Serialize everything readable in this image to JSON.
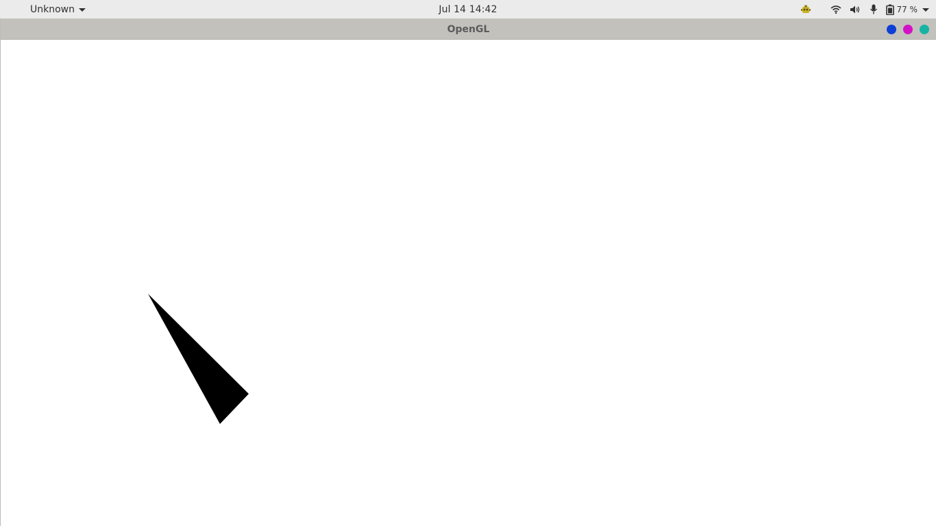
{
  "topbar": {
    "activities_label": "Unknown",
    "clock": "Jul 14  14:42",
    "battery_percent": "77 %",
    "icons": [
      "app-indicator-icon",
      "wifi-icon",
      "volume-icon",
      "microphone-icon",
      "battery-icon",
      "system-menu-caret-icon"
    ]
  },
  "window": {
    "title": "OpenGL",
    "controls": [
      {
        "name": "minimize",
        "color": "#0f3fd6"
      },
      {
        "name": "maximize",
        "color": "#d312c8"
      },
      {
        "name": "close",
        "color": "#16b3a3"
      }
    ]
  },
  "scene": {
    "background": "#ffffff",
    "shape": "triangle",
    "fill": "#000000"
  }
}
